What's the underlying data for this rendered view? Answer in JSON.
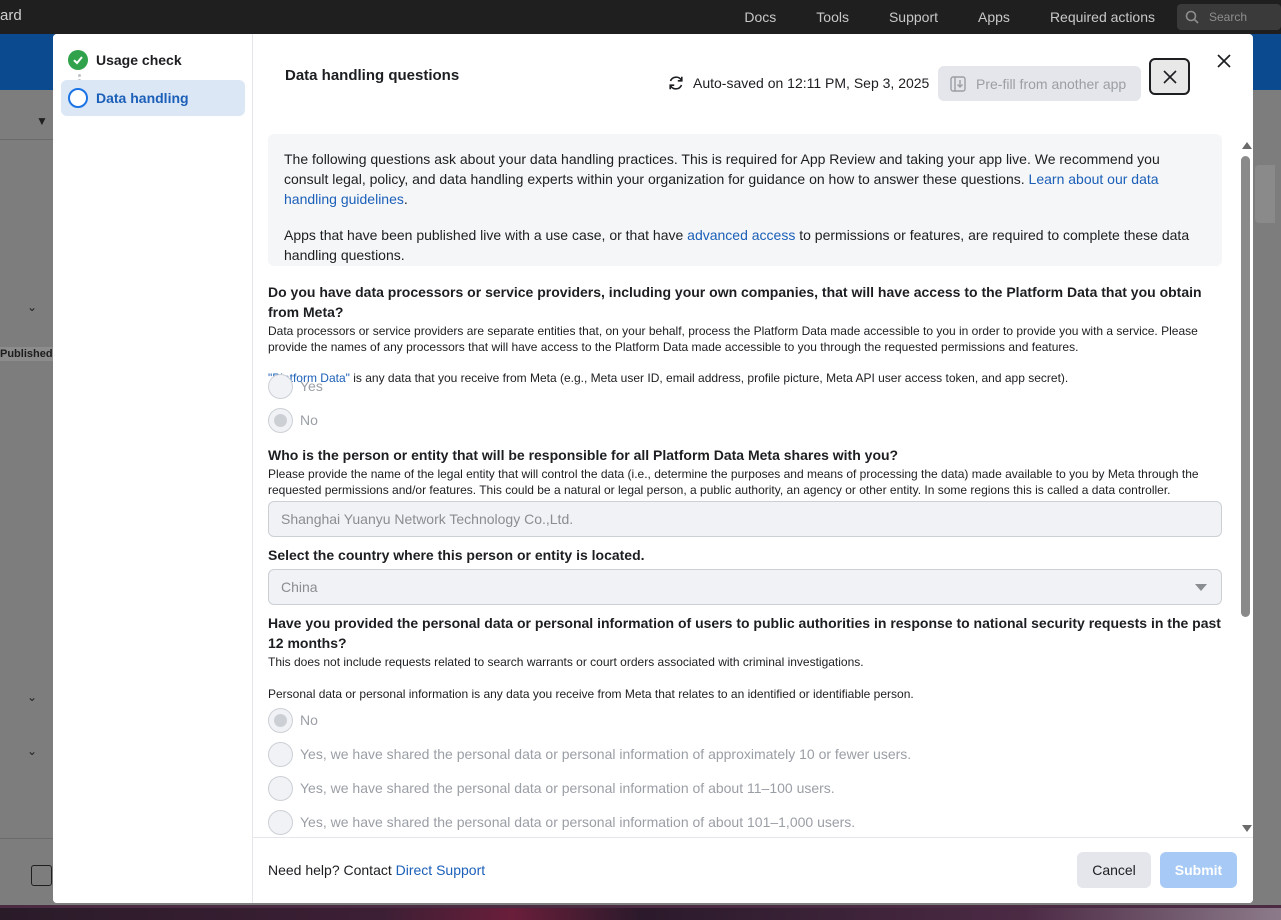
{
  "topbar": {
    "brand": "ard",
    "nav": [
      "Docs",
      "Tools",
      "Support",
      "Apps",
      "Required actions"
    ],
    "search_placeholder": "Search"
  },
  "background": {
    "published_label": "Published"
  },
  "steps": [
    {
      "label": "Usage check",
      "status": "complete"
    },
    {
      "label": "Data handling",
      "status": "current"
    }
  ],
  "header": {
    "title": "Data handling questions",
    "autosave": "Auto-saved on 12:11 PM, Sep 3, 2025",
    "prefill_label": "Pre-fill from another app"
  },
  "info": {
    "p1_text": "The following questions ask about your data handling practices. This is required for App Review and taking your app live. We recommend you consult legal, policy, and data handling experts within your organization for guidance on how to answer these questions. ",
    "p1_link": "Learn about our data handling guidelines",
    "p1_end": ".",
    "p2_start": "Apps that have been published live with a use case, or that have ",
    "p2_link": "advanced access",
    "p2_end": " to permissions or features, are required to complete these data handling questions."
  },
  "q1": {
    "title": "Do you have data processors or service providers, including your own companies, that will have access to the Platform Data that you obtain from Meta?",
    "desc": "Data processors or service providers are separate entities that, on your behalf, process the Platform Data made accessible to you in order to provide you with a service. Please provide the names of any processors that will have access to the Platform Data made accessible to you through the requested permissions and features.",
    "note_link": "\"Platform Data\"",
    "note_text": " is any data that you receive from Meta (e.g., Meta user ID, email address, profile picture, Meta API user access token, and app secret).",
    "options": [
      "Yes",
      "No"
    ],
    "selected": "No"
  },
  "q2": {
    "title": "Who is the person or entity that will be responsible for all Platform Data Meta shares with you?",
    "desc": "Please provide the name of the legal entity that will control the data (i.e., determine the purposes and means of processing the data) made available to you by Meta through the requested permissions and/or features. This could be a natural or legal person, a public authority, an agency or other entity. In some regions this is called a data controller.",
    "value": "Shanghai Yuanyu Network Technology Co.,Ltd."
  },
  "q3": {
    "title": "Select the country where this person or entity is located.",
    "value": "China"
  },
  "q4": {
    "title": "Have you provided the personal data or personal information of users to public authorities in response to national security requests in the past 12 months?",
    "desc": "This does not include requests related to search warrants or court orders associated with criminal investigations.",
    "note": "Personal data or personal information is any data you receive from Meta that relates to an identified or identifiable person.",
    "options": [
      "No",
      "Yes, we have shared the personal data or personal information of approximately 10 or fewer users.",
      "Yes, we have shared the personal data or personal information of about 11–100 users.",
      "Yes, we have shared the personal data or personal information of about 101–1,000 users."
    ],
    "selected": "No"
  },
  "footer": {
    "help_text": "Need help? Contact ",
    "help_link": "Direct Support",
    "cancel_label": "Cancel",
    "submit_label": "Submit"
  },
  "colors": {
    "accent": "#1b74e4",
    "link": "#1b5fb8",
    "success": "#31a24c",
    "submit_disabled": "#a6c9f5"
  },
  "icons": {
    "step_complete": "check-circle-icon",
    "step_current": "ring-icon",
    "autosave": "sync-icon",
    "prefill": "import-icon",
    "close": "close-icon",
    "search": "search-icon"
  }
}
